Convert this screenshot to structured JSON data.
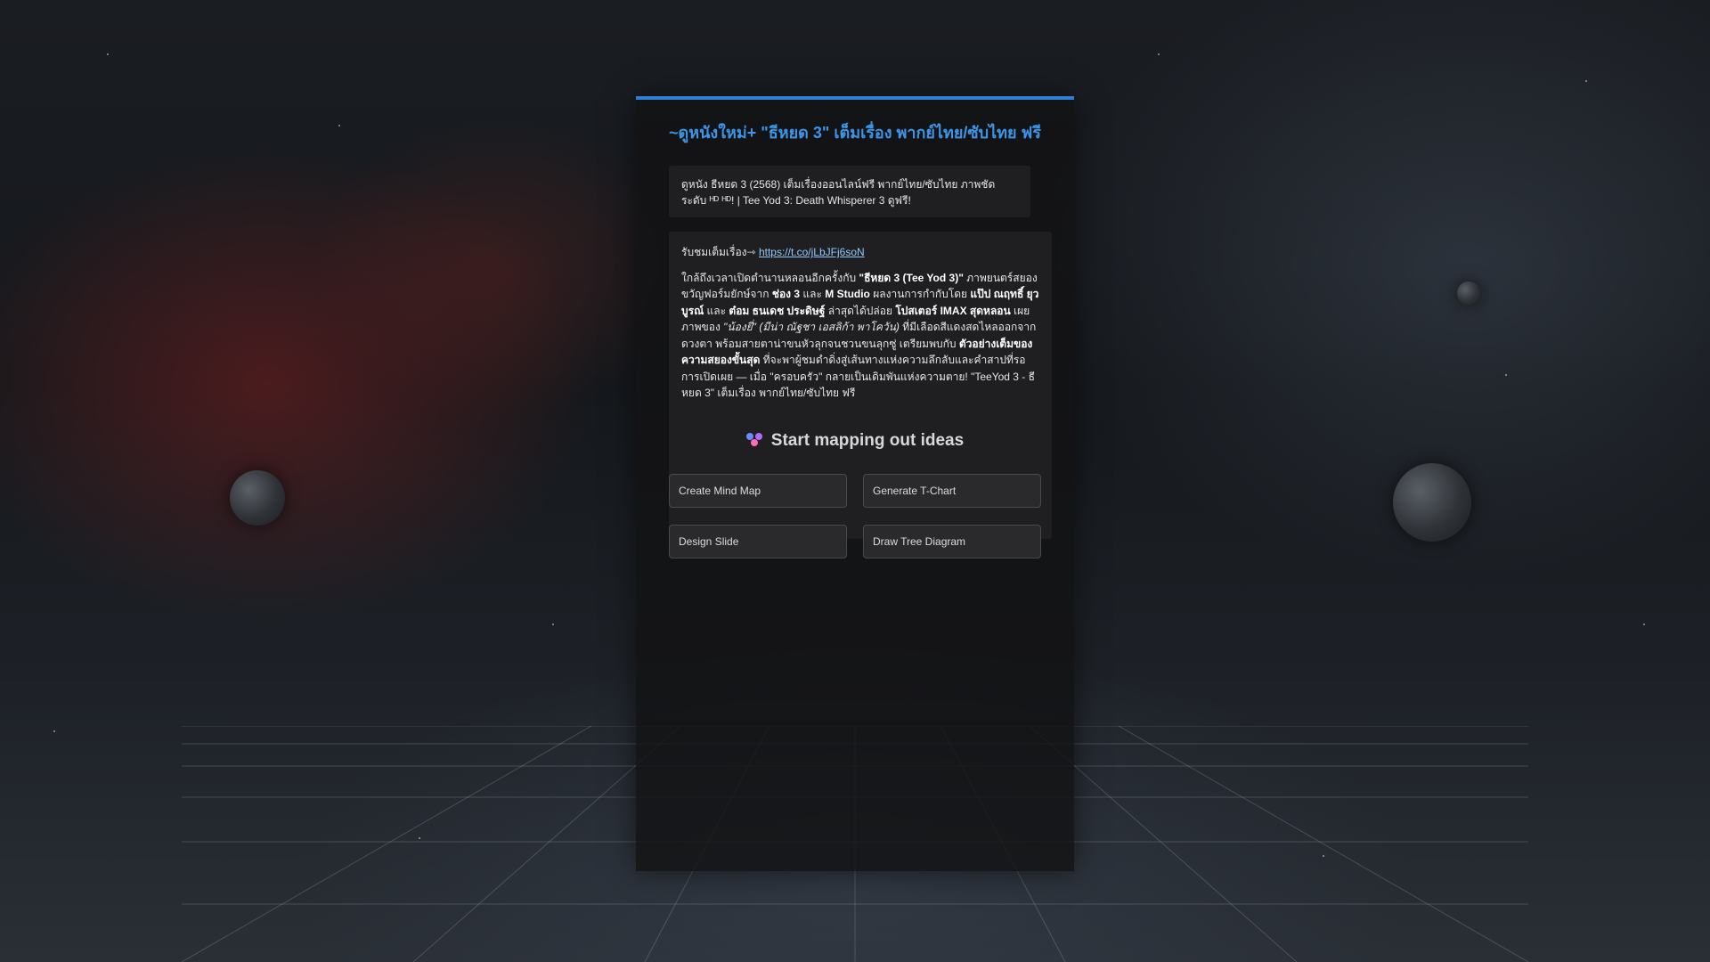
{
  "header": {
    "title": "~ดูหนังใหม่+ \"ธีหยด 3\" เต็มเรื่อง พากย์ไทย/ซับไทย ฟรี"
  },
  "summary": {
    "text": "ดูหนัง ธีหยด 3 (2568) เต็มเรื่องออนไลน์ฟรี พากย์ไทย/ซับไทย ภาพชัดระดับ ᴴᴰ ᴴᴰ! | Tee Yod 3: Death Whisperer 3 ดูฟรี!"
  },
  "content": {
    "watch_prefix": "รับชมเต็มเรื่อง⇾ ",
    "watch_link": "https://t.co/jLbJFj6soN",
    "d1": "ใกล้ถึงเวลาเปิดตำนานหลอนอีกครั้งกับ ",
    "d2": "\"ธีหยด 3 (Tee Yod 3)\"",
    "d3": " ภาพยนตร์สยองขวัญฟอร์มยักษ์จาก ",
    "d4": "ช่อง 3",
    "d5": " และ ",
    "d6": "M Studio",
    "d7": " ผลงานการกำกับโดย ",
    "d8": "แป๊ป ณฤทธิ์ ยุวบูรณ์",
    "d9": " และ ",
    "d10": "ต๋อม ธนเดช ประดิษฐ์",
    "d11": " ล่าสุดได้ปล่อย ",
    "d12": "โปสเตอร์ IMAX สุดหลอน",
    "d13": " เผยภาพของ ",
    "d14": "\"น้องยี่\" (มีน่า ณัฐชา เอสลิก้า พาโควัน)",
    "d15": " ที่มีเลือดสีแดงสดไหลออกจากดวงตา พร้อมสายตาน่าขนหัวลุกจนชวนขนลุกซู่ เตรียมพบกับ ",
    "d16": "ตัวอย่างเต็มของความสยองขั้นสุด",
    "d17": " ที่จะพาผู้ชมดำดิ่งสู่เส้นทางแห่งความลึกลับและคำสาปที่รอการเปิดเผย — เมื่อ \"ครอบครัว\" กลายเป็นเดิมพันแห่งความตาย!  \"TeeYod 3 -  ธีหยด 3\" เต็มเรื่อง พากย์ไทย/ซับไทย ฟรี"
  },
  "ideas": {
    "heading": "Start mapping out ideas",
    "icon": "mind-map-icon",
    "buttons": {
      "mind_map": "Create Mind Map",
      "t_chart": "Generate T-Chart",
      "slide": "Design Slide",
      "tree": "Draw Tree Diagram"
    }
  },
  "colors": {
    "accent": "#2f7fd6",
    "title": "#3b95e8",
    "link": "#8ec9ff"
  }
}
